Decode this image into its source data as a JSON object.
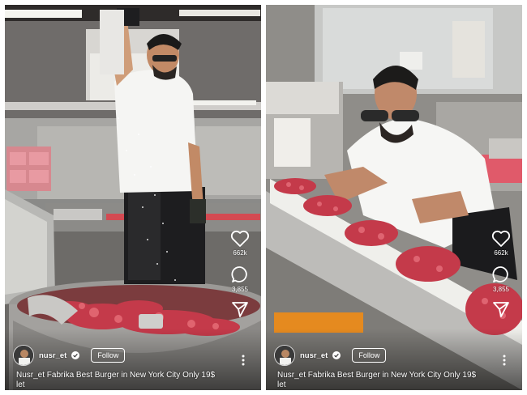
{
  "left_reel": {
    "metrics": {
      "likes": "662k",
      "comments": "3,855"
    },
    "user": {
      "name": "nusr_et"
    },
    "follow_label": "Follow",
    "caption_line1": "Nusr_et Fabrika Best Burger in New York City Only 19$",
    "caption_line2": "let",
    "icons": [
      "heart-icon",
      "comment-icon",
      "share-icon",
      "more-icon",
      "verified-icon"
    ]
  },
  "right_reel": {
    "metrics": {
      "likes": "662k",
      "comments": "3,855"
    },
    "user": {
      "name": "nusr_et"
    },
    "follow_label": "Follow",
    "caption_line1": "Nusr_et Fabrika Best Burger in New York City Only 19$",
    "caption_line2": "let",
    "icons": [
      "heart-icon",
      "comment-icon",
      "share-icon",
      "more-icon",
      "verified-icon"
    ]
  },
  "colors": {
    "meat": "#c43a4a",
    "shirt": "#f4f4f2",
    "belt": "#f0f0ee",
    "accent_orange": "#e58a1f"
  }
}
